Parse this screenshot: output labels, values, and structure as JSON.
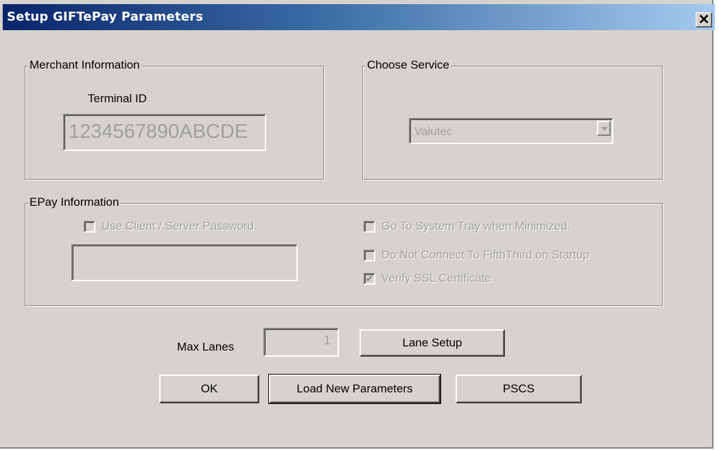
{
  "window": {
    "title": "Setup GIFTePay Parameters",
    "close_glyph": "✕"
  },
  "merchant": {
    "legend": "Merchant Information",
    "terminal_label": "Terminal ID",
    "terminal_value": "1234567890ABCDE"
  },
  "service": {
    "legend": "Choose Service",
    "selected": "Valutec"
  },
  "epay": {
    "legend": "EPay Information",
    "use_password_label": "Use Client / Server Password",
    "use_password_checked": false,
    "password_value": "",
    "system_tray_label": "Go To System Tray when Minimized.",
    "system_tray_checked": false,
    "no_connect_label": "Do Not Connect To FifthThird on Startup",
    "no_connect_checked": false,
    "verify_ssl_label": "Verify SSL Certificate",
    "verify_ssl_checked": true,
    "check_glyph": "✔"
  },
  "lanes": {
    "label": "Max Lanes",
    "value": "1",
    "setup_label": "Lane Setup"
  },
  "buttons": {
    "ok": "OK",
    "load": "Load New Parameters",
    "pscs": "PSCS"
  },
  "colors": {
    "face": "#d6d3ce",
    "title_start": "#0a246a",
    "title_end": "#a6caf0",
    "disabled_text": "#a0a0a0"
  }
}
